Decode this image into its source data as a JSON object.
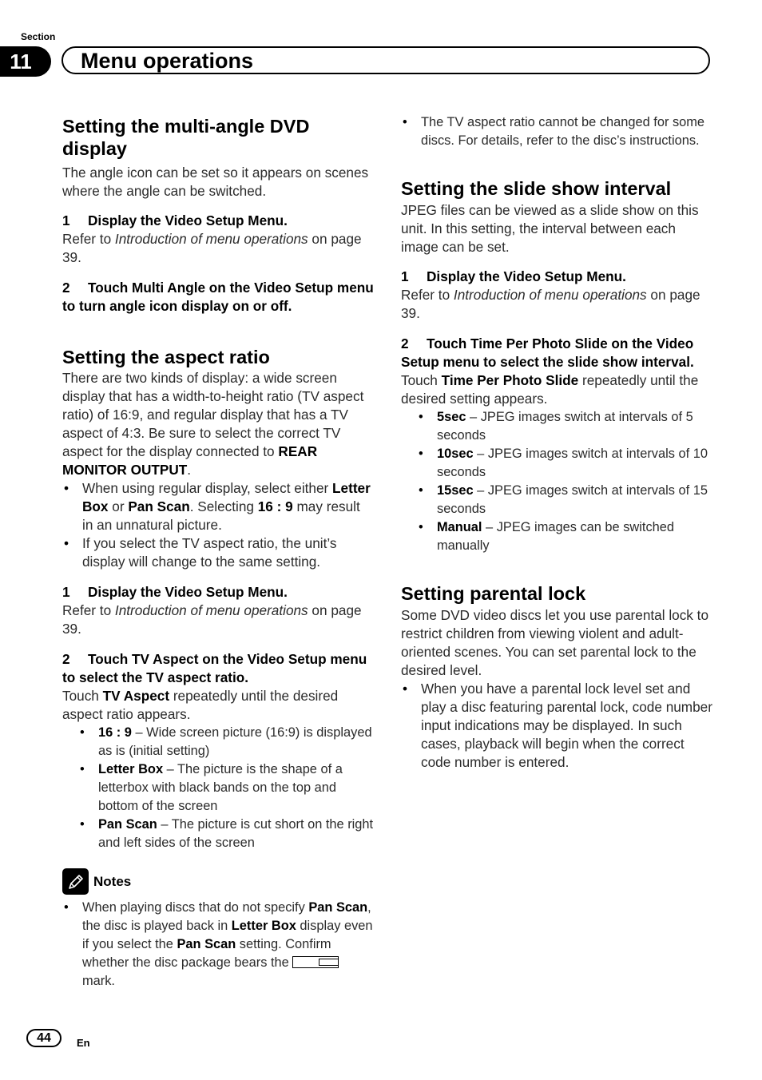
{
  "header": {
    "section_label": "Section",
    "section_number": "11",
    "title": "Menu operations"
  },
  "left": {
    "multi_angle": {
      "heading": "Setting the multi-angle DVD display",
      "intro": "The angle icon can be set so it appears on scenes where the angle can be switched.",
      "step1": {
        "num": "1",
        "text": "Display the Video Setup Menu."
      },
      "step1_ref": {
        "prefix": "Refer to ",
        "link": "Introduction of menu operations",
        "suffix": " on page 39."
      },
      "step2": {
        "num": "2",
        "text": "Touch Multi Angle on the Video Setup menu to turn angle icon display on or off."
      }
    },
    "aspect": {
      "heading": "Setting the aspect ratio",
      "intro": "There are two kinds of display: a wide screen display that has a width-to-height ratio (TV aspect ratio) of 16:9, and regular display that has a TV aspect of 4:3. Be sure to select the correct TV aspect for the display connected to ",
      "intro_bold": "REAR MONITOR OUTPUT",
      "intro_end": ".",
      "bullets": [
        {
          "t1": "When using regular display, select either ",
          "b1": "Letter Box",
          "t2": " or ",
          "b2": "Pan Scan",
          "t3": ". Selecting ",
          "b3": "16 : 9",
          "t4": " may result in an unnatural picture."
        },
        {
          "text": "If you select the TV aspect ratio, the unit’s display will change to the same setting."
        }
      ],
      "step1": {
        "num": "1",
        "text": "Display the Video Setup Menu."
      },
      "step1_ref": {
        "prefix": "Refer to ",
        "link": "Introduction of menu operations",
        "suffix": " on page 39."
      },
      "step2": {
        "num": "2",
        "text": "Touch TV Aspect on the Video Setup menu to select the TV aspect ratio."
      },
      "touch": {
        "prefix": "Touch ",
        "bold": "TV Aspect",
        "suffix": " repeatedly until the desired aspect ratio appears."
      },
      "options": [
        {
          "name": "16 : 9",
          "desc": " – Wide screen picture (16:9) is displayed as is (initial setting)"
        },
        {
          "name": "Letter Box",
          "desc": " – The picture is the shape of a letterbox with black bands on the top and bottom of the screen"
        },
        {
          "name": "Pan Scan",
          "desc": " – The picture is cut short on the right and left sides of the screen"
        }
      ]
    },
    "notes": {
      "heading": "Notes",
      "icon": "pencil-icon",
      "bullet": {
        "t1": "When playing discs that do not specify ",
        "b1": "Pan Scan",
        "t2": ", the disc is played back in ",
        "b2": "Letter Box",
        "t3": " display even if you select the ",
        "b3": "Pan Scan",
        "t4": " setting. Confirm whether the disc package bears the ",
        "t5": " mark."
      }
    }
  },
  "right": {
    "aspect_bullet": "The TV aspect ratio cannot be changed for some discs. For details, refer to the disc’s instructions.",
    "slideshow": {
      "heading": "Setting the slide show interval",
      "intro": "JPEG files can be viewed as a slide show on this unit. In this setting, the interval between each image can be set.",
      "step1": {
        "num": "1",
        "text": "Display the Video Setup Menu."
      },
      "step1_ref": {
        "prefix": "Refer to ",
        "link": "Introduction of menu operations",
        "suffix": " on page 39."
      },
      "step2": {
        "num": "2",
        "text": "Touch Time Per Photo Slide on the Video Setup menu to select the slide show interval."
      },
      "touch": {
        "prefix": "Touch ",
        "bold": "Time Per Photo Slide",
        "suffix": " repeatedly until the desired setting appears."
      },
      "options": [
        {
          "name": "5sec",
          "desc": " – JPEG images switch at intervals of 5 seconds"
        },
        {
          "name": "10sec",
          "desc": " – JPEG images switch at intervals of 10 seconds"
        },
        {
          "name": "15sec",
          "desc": " – JPEG images switch at intervals of 15 seconds"
        },
        {
          "name": "Manual",
          "desc": " – JPEG images can be switched manually"
        }
      ]
    },
    "parental": {
      "heading": "Setting parental lock",
      "intro": "Some DVD video discs let you use parental lock to restrict children from viewing violent and adult-oriented scenes. You can set parental lock to the desired level.",
      "bullet": "When you have a parental lock level set and play a disc featuring parental lock, code number input indications may be displayed. In such cases, playback will begin when the correct code number is entered."
    }
  },
  "footer": {
    "page_number": "44",
    "language": "En"
  }
}
